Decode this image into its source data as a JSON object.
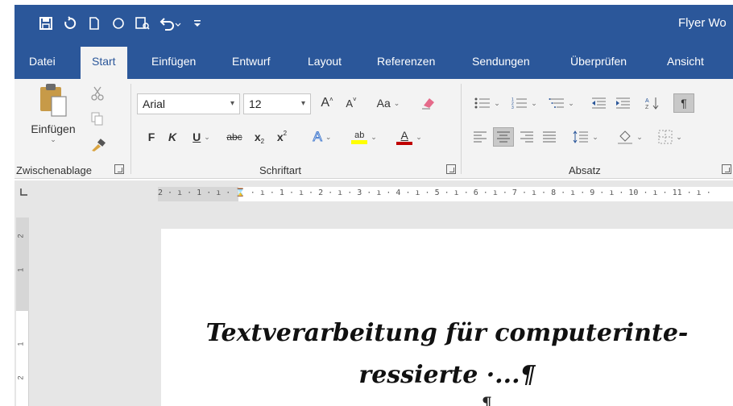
{
  "title_bar": {
    "doc_title": "Flyer Wo",
    "quick_access": [
      "save-icon",
      "autosave-icon",
      "new-document-icon",
      "circle-icon",
      "print-preview-icon",
      "undo-icon",
      "customize-icon"
    ]
  },
  "tabs": [
    {
      "label": "Datei"
    },
    {
      "label": "Start"
    },
    {
      "label": "Einfügen"
    },
    {
      "label": "Entwurf"
    },
    {
      "label": "Layout"
    },
    {
      "label": "Referenzen"
    },
    {
      "label": "Sendungen"
    },
    {
      "label": "Überprüfen"
    },
    {
      "label": "Ansicht"
    }
  ],
  "ribbon": {
    "clipboard": {
      "group_label": "Zwischenablage",
      "paste_label": "Einfügen"
    },
    "font": {
      "group_label": "Schriftart",
      "font_name": "Arial",
      "font_size": "12",
      "grow": "A",
      "shrink": "A",
      "case": "Aa",
      "bold": "F",
      "italic": "K",
      "underline": "U",
      "strikethrough": "abc",
      "subscript": "x",
      "superscript": "x",
      "text_effects": "A",
      "highlight": "ab",
      "font_color": "A"
    },
    "paragraph": {
      "group_label": "Absatz",
      "sort": "A Z",
      "show_marks": "¶"
    }
  },
  "ruler": {
    "horizontal": "2 · ı · 1 · ı · ⌛ · ı · 1 · ı · 2 · ı · 3 · ı · 4 · ı · 5 · ı · 6 · ı · 7 · ı · 8 · ı · 9 · ı · 10 · ı · 11 · ı ·",
    "vertical": [
      "2",
      "1",
      "1",
      "2"
    ]
  },
  "document": {
    "line1": "Textverarbeitung für computerinte-",
    "line2": "ressierte ·...¶",
    "line3": "¶"
  },
  "colors": {
    "accent": "#2b579a",
    "ribbon": "#f3f3f3",
    "highlight": "#ffff00",
    "font_color": "#c00000"
  }
}
